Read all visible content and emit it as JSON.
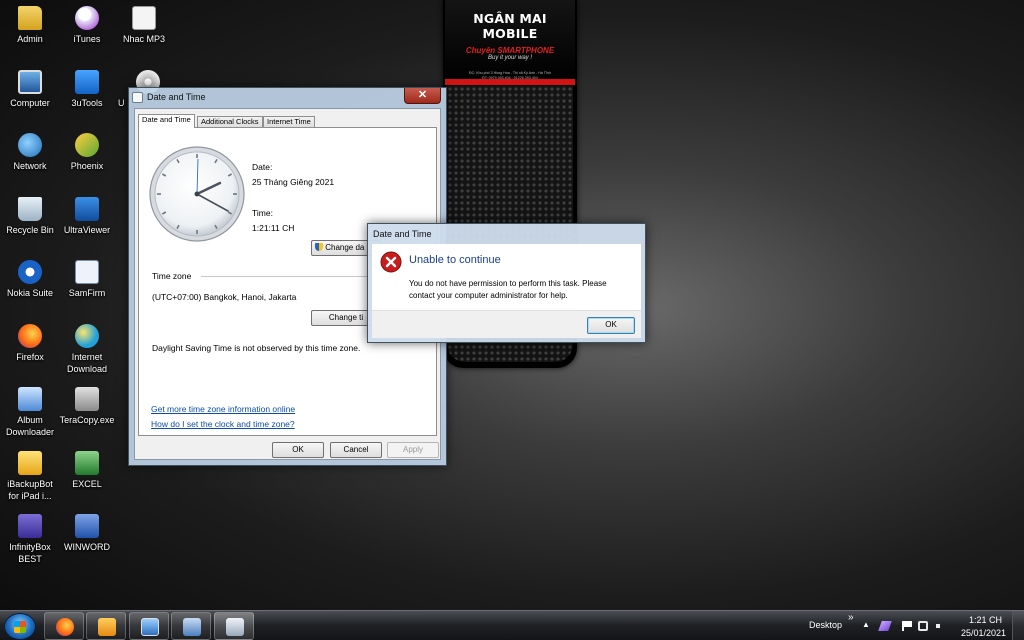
{
  "wallpaper": {
    "brand": "NGÂN MAI MOBILE",
    "tagline_red": "Chuyên SMARTPHONE",
    "tagline_sub": "Buy it your way !",
    "address": "ĐC: Khu phố 3 Hồng Hoa - Thị xã Kỳ Anh - Hà Tĩnh",
    "phones": "ĐT: 0979.393.404 - 01226.393.404"
  },
  "desktop_icons": [
    {
      "label": "Admin",
      "icon": "folder-icon"
    },
    {
      "label": "iTunes",
      "icon": "itunes-icon"
    },
    {
      "label": "Nhac MP3",
      "icon": "document-icon"
    },
    {
      "label": "Computer",
      "icon": "computer-icon"
    },
    {
      "label": "3uTools",
      "icon": "3utools-icon"
    },
    {
      "label": "U",
      "icon": "disc-icon"
    },
    {
      "label": "Network",
      "icon": "network-icon"
    },
    {
      "label": "Phoenix",
      "icon": "phoenix-icon"
    },
    {
      "label": "Recycle Bin",
      "icon": "recycle-bin-icon"
    },
    {
      "label": "UltraViewer",
      "icon": "ultraviewer-icon"
    },
    {
      "label": "Nokia Suite",
      "icon": "nokia-suite-icon"
    },
    {
      "label": "SamFirm",
      "icon": "samfirm-icon"
    },
    {
      "label": "Firefox",
      "icon": "firefox-icon"
    },
    {
      "label": "Internet Download",
      "icon": "idm-icon"
    },
    {
      "label": "Album Downloader",
      "icon": "album-downloader-icon"
    },
    {
      "label": "TeraCopy.exe",
      "icon": "teracopy-icon"
    },
    {
      "label": "iBackupBot for iPad i...",
      "icon": "ibackupbot-icon"
    },
    {
      "label": "EXCEL",
      "icon": "excel-icon"
    },
    {
      "label": "InfinityBox BEST",
      "icon": "infinitybox-icon"
    },
    {
      "label": "WINWORD",
      "icon": "word-icon"
    }
  ],
  "date_time_window": {
    "title": "Date and Time",
    "close_glyph": "✕",
    "tabs": [
      "Date and Time",
      "Additional Clocks",
      "Internet Time"
    ],
    "date_label": "Date:",
    "date_value": "25 Tháng Giêng 2021",
    "time_label": "Time:",
    "time_value": "1:21:11 CH",
    "change_date_button": "Change da",
    "time_zone_heading": "Time zone",
    "time_zone_value": "(UTC+07:00) Bangkok, Hanoi, Jakarta",
    "change_tz_button": "Change ti",
    "dst_text": "Daylight Saving Time is not observed by this time zone.",
    "link_more_tz": "Get more time zone information online",
    "link_how_set": "How do I set the clock and time zone?",
    "ok": "OK",
    "cancel": "Cancel",
    "apply": "Apply"
  },
  "error_dialog": {
    "title": "Date and Time",
    "heading": "Unable to continue",
    "message_line1": "You do not have permission to perform this task. Please",
    "message_line2": "contact your computer administrator for help.",
    "ok": "OK",
    "heading_color": "#1a3f8f"
  },
  "taskbar": {
    "desktop_label": "Desktop",
    "chevron": "»",
    "time": "1:21 CH",
    "date": "25/01/2021",
    "pinned": [
      "firefox-icon",
      "media-player-icon",
      "remote-desktop-icon",
      "control-panel-icon",
      "date-time-icon"
    ]
  }
}
